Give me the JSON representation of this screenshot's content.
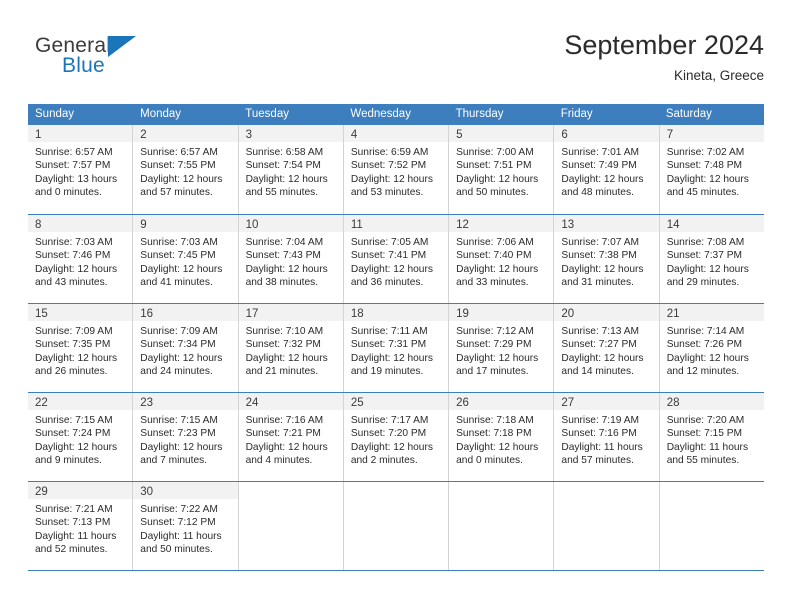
{
  "brand": {
    "name_part1": "General",
    "name_part2": "Blue",
    "flag_icon": "triangle-flag-icon",
    "accent_color": "#1b75bb"
  },
  "header": {
    "month_title": "September 2024",
    "location": "Kineta, Greece"
  },
  "calendar": {
    "header_bg_color": "#3d7ebe",
    "day_band_bg_color": "#f2f2f2",
    "weekdays": [
      "Sunday",
      "Monday",
      "Tuesday",
      "Wednesday",
      "Thursday",
      "Friday",
      "Saturday"
    ],
    "weeks": [
      [
        {
          "day": "1",
          "sunrise": "Sunrise: 6:57 AM",
          "sunset": "Sunset: 7:57 PM",
          "daylight_line1": "Daylight: 13 hours",
          "daylight_line2": "and 0 minutes."
        },
        {
          "day": "2",
          "sunrise": "Sunrise: 6:57 AM",
          "sunset": "Sunset: 7:55 PM",
          "daylight_line1": "Daylight: 12 hours",
          "daylight_line2": "and 57 minutes."
        },
        {
          "day": "3",
          "sunrise": "Sunrise: 6:58 AM",
          "sunset": "Sunset: 7:54 PM",
          "daylight_line1": "Daylight: 12 hours",
          "daylight_line2": "and 55 minutes."
        },
        {
          "day": "4",
          "sunrise": "Sunrise: 6:59 AM",
          "sunset": "Sunset: 7:52 PM",
          "daylight_line1": "Daylight: 12 hours",
          "daylight_line2": "and 53 minutes."
        },
        {
          "day": "5",
          "sunrise": "Sunrise: 7:00 AM",
          "sunset": "Sunset: 7:51 PM",
          "daylight_line1": "Daylight: 12 hours",
          "daylight_line2": "and 50 minutes."
        },
        {
          "day": "6",
          "sunrise": "Sunrise: 7:01 AM",
          "sunset": "Sunset: 7:49 PM",
          "daylight_line1": "Daylight: 12 hours",
          "daylight_line2": "and 48 minutes."
        },
        {
          "day": "7",
          "sunrise": "Sunrise: 7:02 AM",
          "sunset": "Sunset: 7:48 PM",
          "daylight_line1": "Daylight: 12 hours",
          "daylight_line2": "and 45 minutes."
        }
      ],
      [
        {
          "day": "8",
          "sunrise": "Sunrise: 7:03 AM",
          "sunset": "Sunset: 7:46 PM",
          "daylight_line1": "Daylight: 12 hours",
          "daylight_line2": "and 43 minutes."
        },
        {
          "day": "9",
          "sunrise": "Sunrise: 7:03 AM",
          "sunset": "Sunset: 7:45 PM",
          "daylight_line1": "Daylight: 12 hours",
          "daylight_line2": "and 41 minutes."
        },
        {
          "day": "10",
          "sunrise": "Sunrise: 7:04 AM",
          "sunset": "Sunset: 7:43 PM",
          "daylight_line1": "Daylight: 12 hours",
          "daylight_line2": "and 38 minutes."
        },
        {
          "day": "11",
          "sunrise": "Sunrise: 7:05 AM",
          "sunset": "Sunset: 7:41 PM",
          "daylight_line1": "Daylight: 12 hours",
          "daylight_line2": "and 36 minutes."
        },
        {
          "day": "12",
          "sunrise": "Sunrise: 7:06 AM",
          "sunset": "Sunset: 7:40 PM",
          "daylight_line1": "Daylight: 12 hours",
          "daylight_line2": "and 33 minutes."
        },
        {
          "day": "13",
          "sunrise": "Sunrise: 7:07 AM",
          "sunset": "Sunset: 7:38 PM",
          "daylight_line1": "Daylight: 12 hours",
          "daylight_line2": "and 31 minutes."
        },
        {
          "day": "14",
          "sunrise": "Sunrise: 7:08 AM",
          "sunset": "Sunset: 7:37 PM",
          "daylight_line1": "Daylight: 12 hours",
          "daylight_line2": "and 29 minutes."
        }
      ],
      [
        {
          "day": "15",
          "sunrise": "Sunrise: 7:09 AM",
          "sunset": "Sunset: 7:35 PM",
          "daylight_line1": "Daylight: 12 hours",
          "daylight_line2": "and 26 minutes."
        },
        {
          "day": "16",
          "sunrise": "Sunrise: 7:09 AM",
          "sunset": "Sunset: 7:34 PM",
          "daylight_line1": "Daylight: 12 hours",
          "daylight_line2": "and 24 minutes."
        },
        {
          "day": "17",
          "sunrise": "Sunrise: 7:10 AM",
          "sunset": "Sunset: 7:32 PM",
          "daylight_line1": "Daylight: 12 hours",
          "daylight_line2": "and 21 minutes."
        },
        {
          "day": "18",
          "sunrise": "Sunrise: 7:11 AM",
          "sunset": "Sunset: 7:31 PM",
          "daylight_line1": "Daylight: 12 hours",
          "daylight_line2": "and 19 minutes."
        },
        {
          "day": "19",
          "sunrise": "Sunrise: 7:12 AM",
          "sunset": "Sunset: 7:29 PM",
          "daylight_line1": "Daylight: 12 hours",
          "daylight_line2": "and 17 minutes."
        },
        {
          "day": "20",
          "sunrise": "Sunrise: 7:13 AM",
          "sunset": "Sunset: 7:27 PM",
          "daylight_line1": "Daylight: 12 hours",
          "daylight_line2": "and 14 minutes."
        },
        {
          "day": "21",
          "sunrise": "Sunrise: 7:14 AM",
          "sunset": "Sunset: 7:26 PM",
          "daylight_line1": "Daylight: 12 hours",
          "daylight_line2": "and 12 minutes."
        }
      ],
      [
        {
          "day": "22",
          "sunrise": "Sunrise: 7:15 AM",
          "sunset": "Sunset: 7:24 PM",
          "daylight_line1": "Daylight: 12 hours",
          "daylight_line2": "and 9 minutes."
        },
        {
          "day": "23",
          "sunrise": "Sunrise: 7:15 AM",
          "sunset": "Sunset: 7:23 PM",
          "daylight_line1": "Daylight: 12 hours",
          "daylight_line2": "and 7 minutes."
        },
        {
          "day": "24",
          "sunrise": "Sunrise: 7:16 AM",
          "sunset": "Sunset: 7:21 PM",
          "daylight_line1": "Daylight: 12 hours",
          "daylight_line2": "and 4 minutes."
        },
        {
          "day": "25",
          "sunrise": "Sunrise: 7:17 AM",
          "sunset": "Sunset: 7:20 PM",
          "daylight_line1": "Daylight: 12 hours",
          "daylight_line2": "and 2 minutes."
        },
        {
          "day": "26",
          "sunrise": "Sunrise: 7:18 AM",
          "sunset": "Sunset: 7:18 PM",
          "daylight_line1": "Daylight: 12 hours",
          "daylight_line2": "and 0 minutes."
        },
        {
          "day": "27",
          "sunrise": "Sunrise: 7:19 AM",
          "sunset": "Sunset: 7:16 PM",
          "daylight_line1": "Daylight: 11 hours",
          "daylight_line2": "and 57 minutes."
        },
        {
          "day": "28",
          "sunrise": "Sunrise: 7:20 AM",
          "sunset": "Sunset: 7:15 PM",
          "daylight_line1": "Daylight: 11 hours",
          "daylight_line2": "and 55 minutes."
        }
      ],
      [
        {
          "day": "29",
          "sunrise": "Sunrise: 7:21 AM",
          "sunset": "Sunset: 7:13 PM",
          "daylight_line1": "Daylight: 11 hours",
          "daylight_line2": "and 52 minutes."
        },
        {
          "day": "30",
          "sunrise": "Sunrise: 7:22 AM",
          "sunset": "Sunset: 7:12 PM",
          "daylight_line1": "Daylight: 11 hours",
          "daylight_line2": "and 50 minutes."
        },
        {
          "day": "",
          "sunrise": "",
          "sunset": "",
          "daylight_line1": "",
          "daylight_line2": ""
        },
        {
          "day": "",
          "sunrise": "",
          "sunset": "",
          "daylight_line1": "",
          "daylight_line2": ""
        },
        {
          "day": "",
          "sunrise": "",
          "sunset": "",
          "daylight_line1": "",
          "daylight_line2": ""
        },
        {
          "day": "",
          "sunrise": "",
          "sunset": "",
          "daylight_line1": "",
          "daylight_line2": ""
        },
        {
          "day": "",
          "sunrise": "",
          "sunset": "",
          "daylight_line1": "",
          "daylight_line2": ""
        }
      ]
    ]
  }
}
